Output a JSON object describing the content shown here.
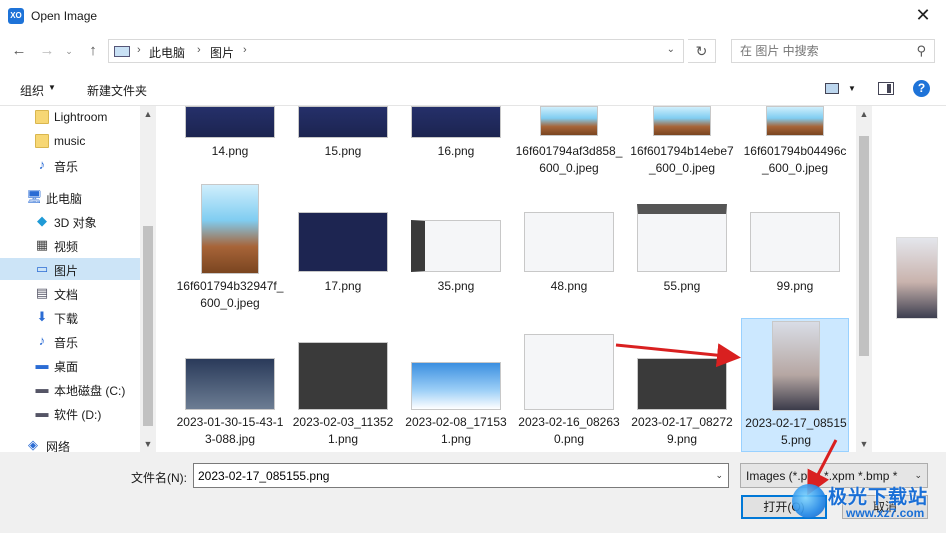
{
  "window": {
    "title": "Open Image",
    "close_glyph": "✕"
  },
  "nav_buttons": {
    "back": "←",
    "forward": "→",
    "recent": "⌄",
    "up": "↑"
  },
  "address": {
    "crumbs": [
      "此电脑",
      "图片"
    ],
    "sep": "›",
    "dropdown": "⌄",
    "refresh": "↻"
  },
  "search": {
    "placeholder": "在 图片 中搜索",
    "icon": "⚲"
  },
  "toolbar": {
    "organize": "组织",
    "organize_caret": "▼",
    "new_folder": "新建文件夹",
    "view_caret": "▼",
    "help": "?"
  },
  "nav_pane": {
    "items": [
      {
        "label": "Lightroom",
        "icon": "folder-icon"
      },
      {
        "label": "music",
        "icon": "folder-icon"
      },
      {
        "label": "音乐",
        "icon": "music-icon",
        "glyph": "♪"
      },
      {
        "label": "此电脑",
        "icon": "computer-icon",
        "glyph": "🖥"
      },
      {
        "label": "3D 对象",
        "icon": "cube-icon",
        "glyph": "◆"
      },
      {
        "label": "视频",
        "icon": "video-icon",
        "glyph": "▦"
      },
      {
        "label": "图片",
        "icon": "pictures-icon",
        "glyph": "▭"
      },
      {
        "label": "文档",
        "icon": "document-icon",
        "glyph": "▤"
      },
      {
        "label": "下载",
        "icon": "download-icon",
        "glyph": "⬇"
      },
      {
        "label": "音乐",
        "icon": "music-icon",
        "glyph": "♪"
      },
      {
        "label": "桌面",
        "icon": "desktop-icon",
        "glyph": "▬"
      },
      {
        "label": "本地磁盘 (C:)",
        "icon": "drive-icon",
        "glyph": "▬"
      },
      {
        "label": "软件 (D:)",
        "icon": "drive-icon",
        "glyph": "▬"
      },
      {
        "label": "网络",
        "icon": "network-icon",
        "glyph": "◈"
      }
    ]
  },
  "scroll": {
    "up": "▲",
    "down": "▼"
  },
  "files": {
    "row1": [
      "14.png",
      "15.png",
      "16.png",
      "16f601794af3d858_600_0.jpeg",
      "16f601794b14ebe7_600_0.jpeg",
      "16f601794b04496c_600_0.jpeg"
    ],
    "row2": [
      "16f601794b32947f_600_0.jpeg",
      "17.png",
      "35.png",
      "48.png",
      "55.png",
      "99.png"
    ],
    "row3": [
      "2023-01-30-15-43-13-088.jpg",
      "2023-02-03_113521.png",
      "2023-02-08_171531.png",
      "2023-02-16_082630.png",
      "2023-02-17_082729.png",
      "2023-02-17_085155.png"
    ],
    "selected": "2023-02-17_085155.png"
  },
  "bottom": {
    "filename_label": "文件名(N):",
    "filename_value": "2023-02-17_085155.png",
    "filetype_value": "Images (*.png *.xpm *.bmp *",
    "caret": "⌄",
    "open_label": "打开(O)",
    "cancel_label": "取消"
  },
  "watermark": {
    "text": "极光下载站",
    "url": "www.xz7.com"
  },
  "colors": {
    "accent": "#0078d7",
    "selection": "#cce8ff",
    "arrow": "#d92020"
  }
}
